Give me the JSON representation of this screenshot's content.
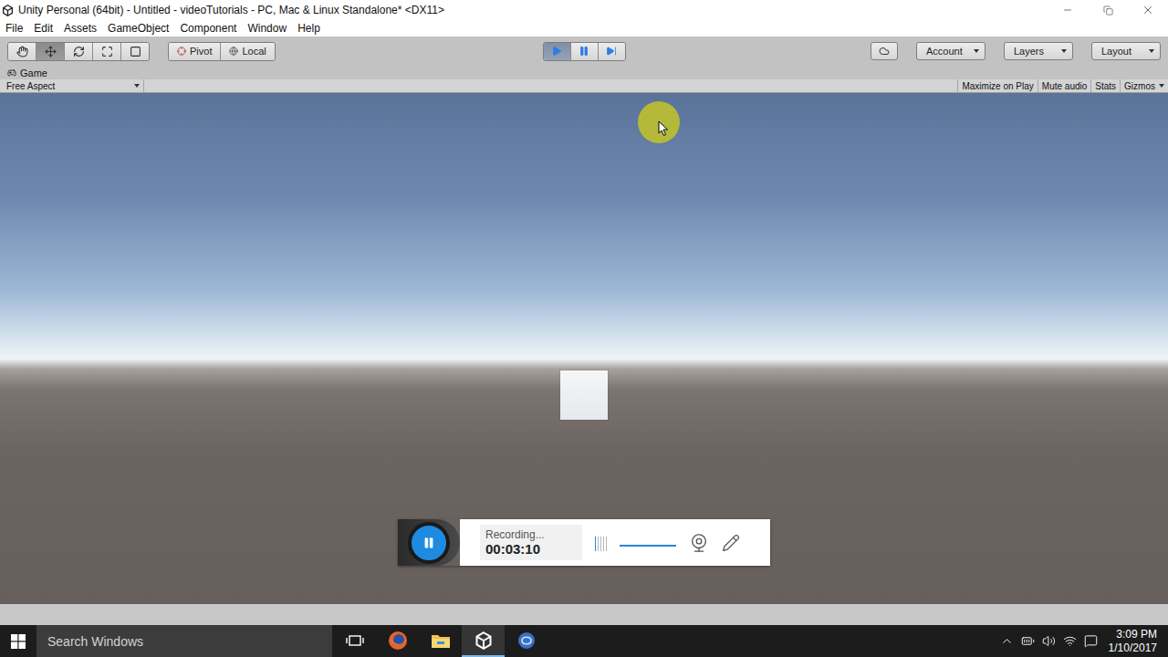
{
  "window": {
    "title": "Unity Personal (64bit) - Untitled - videoTutorials - PC, Mac & Linux Standalone* <DX11>"
  },
  "menu": [
    "File",
    "Edit",
    "Assets",
    "GameObject",
    "Component",
    "Window",
    "Help"
  ],
  "tools": [
    {
      "kind": "hand",
      "selected": false
    },
    {
      "kind": "move",
      "selected": true
    },
    {
      "kind": "rotate",
      "selected": false
    },
    {
      "kind": "scale",
      "selected": false
    },
    {
      "kind": "rect",
      "selected": false
    }
  ],
  "handle_toggles": [
    {
      "kind": "pivot",
      "label": "Pivot"
    },
    {
      "kind": "local",
      "label": "Local"
    }
  ],
  "playback": [
    {
      "kind": "play",
      "selected": true
    },
    {
      "kind": "pause",
      "selected": false
    },
    {
      "kind": "step",
      "selected": false
    }
  ],
  "right_dropdowns": [
    "Account",
    "Layers",
    "Layout"
  ],
  "game_tab": {
    "label": "Game"
  },
  "aspect": {
    "label": "Free Aspect"
  },
  "view_toggles": [
    {
      "label": "Maximize on Play",
      "selected": false,
      "dropdown": false
    },
    {
      "label": "Mute audio",
      "selected": false,
      "dropdown": false
    },
    {
      "label": "Stats",
      "selected": false,
      "dropdown": false
    },
    {
      "label": "Gizmos",
      "selected": false,
      "dropdown": true
    }
  ],
  "recorder": {
    "status": "Recording...",
    "time": "00:03:10",
    "mic_level": 0.2,
    "volume": 1.0
  },
  "taskbar": {
    "search_placeholder": "Search Windows",
    "apps": [
      {
        "kind": "task-view",
        "active": false
      },
      {
        "kind": "firefox",
        "active": false
      },
      {
        "kind": "explorer",
        "active": false
      },
      {
        "kind": "unity",
        "active": true
      },
      {
        "kind": "app",
        "active": false
      }
    ],
    "tray": [
      "chevron",
      "battery",
      "volume",
      "wifi",
      "notification"
    ],
    "time": "3:09 PM",
    "date": "1/10/2017"
  }
}
